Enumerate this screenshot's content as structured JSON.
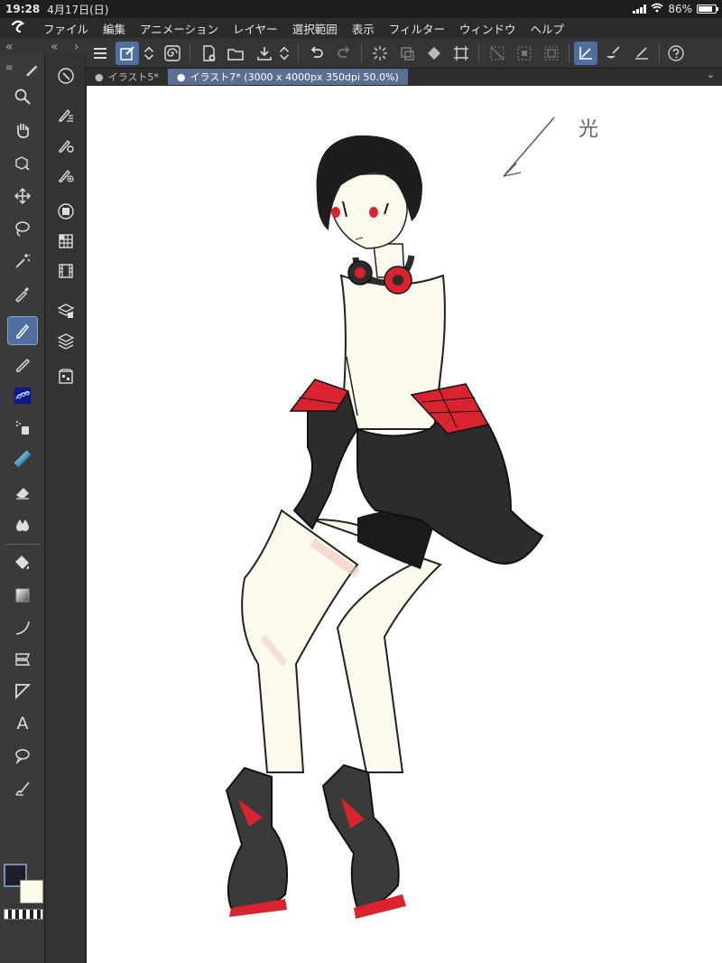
{
  "status": {
    "time": "19:28",
    "date": "4月17日(日)",
    "battery": "86%",
    "battery_level": 0.86
  },
  "menu": {
    "items": [
      "ファイル",
      "編集",
      "アニメーション",
      "レイヤー",
      "選択範囲",
      "表示",
      "フィルター",
      "ウィンドウ",
      "ヘルプ"
    ]
  },
  "tabs": [
    {
      "label": "イラスト5*",
      "active": false
    },
    {
      "label": "イラスト7* (3000 x 4000px 350dpi 50.0%)",
      "active": true
    }
  ],
  "canvas": {
    "note": "光"
  },
  "colors": {
    "main": "#1d1f2a",
    "sub": "#fcfbec",
    "accent": "#4f6f9f"
  }
}
